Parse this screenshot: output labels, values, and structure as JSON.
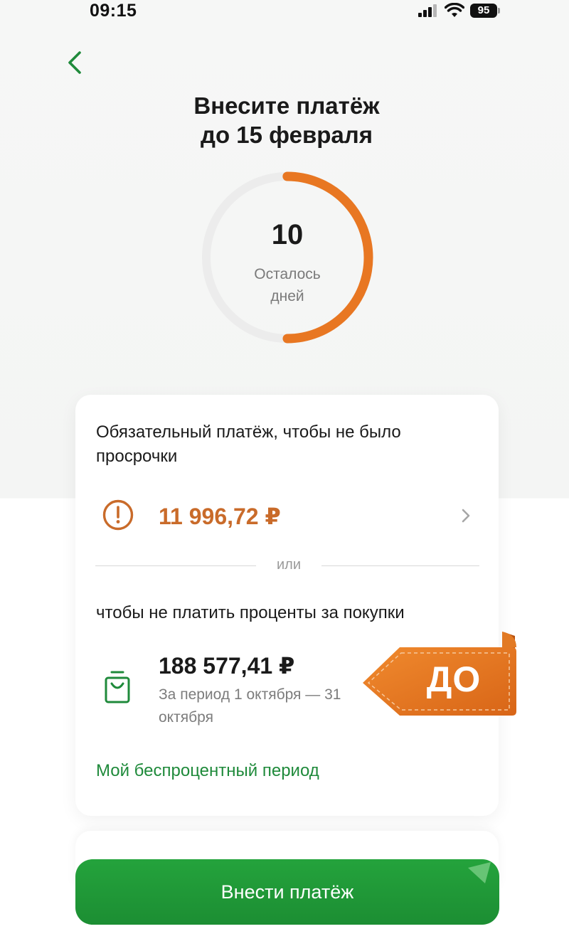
{
  "status_bar": {
    "time": "09:15",
    "battery": "95"
  },
  "header": {
    "title_line1": "Внесите платёж",
    "title_line2": "до 15 февраля"
  },
  "countdown": {
    "days_left": "10",
    "caption": "Осталось дней",
    "progress_fraction": 0.5,
    "progress_color": "#e87722",
    "track_color": "#ececec"
  },
  "card": {
    "heading": "Обязательный платёж, чтобы не было просрочки",
    "min_payment": "11 996,72 ₽",
    "divider_label": "или",
    "subheading": "чтобы не платить проценты за покупки",
    "full_amount": "188 577,41 ₽",
    "period": "За период 1 октября — 31 октября",
    "grace_link": "Мой беспроцентный период"
  },
  "sticker": {
    "label": "ДО",
    "color": "#e87722"
  },
  "pay_button": {
    "label": "Внести платёж",
    "color": "#21a038"
  },
  "colors": {
    "accent_green": "#1f8a3b",
    "warning_orange": "#c96b2a"
  }
}
